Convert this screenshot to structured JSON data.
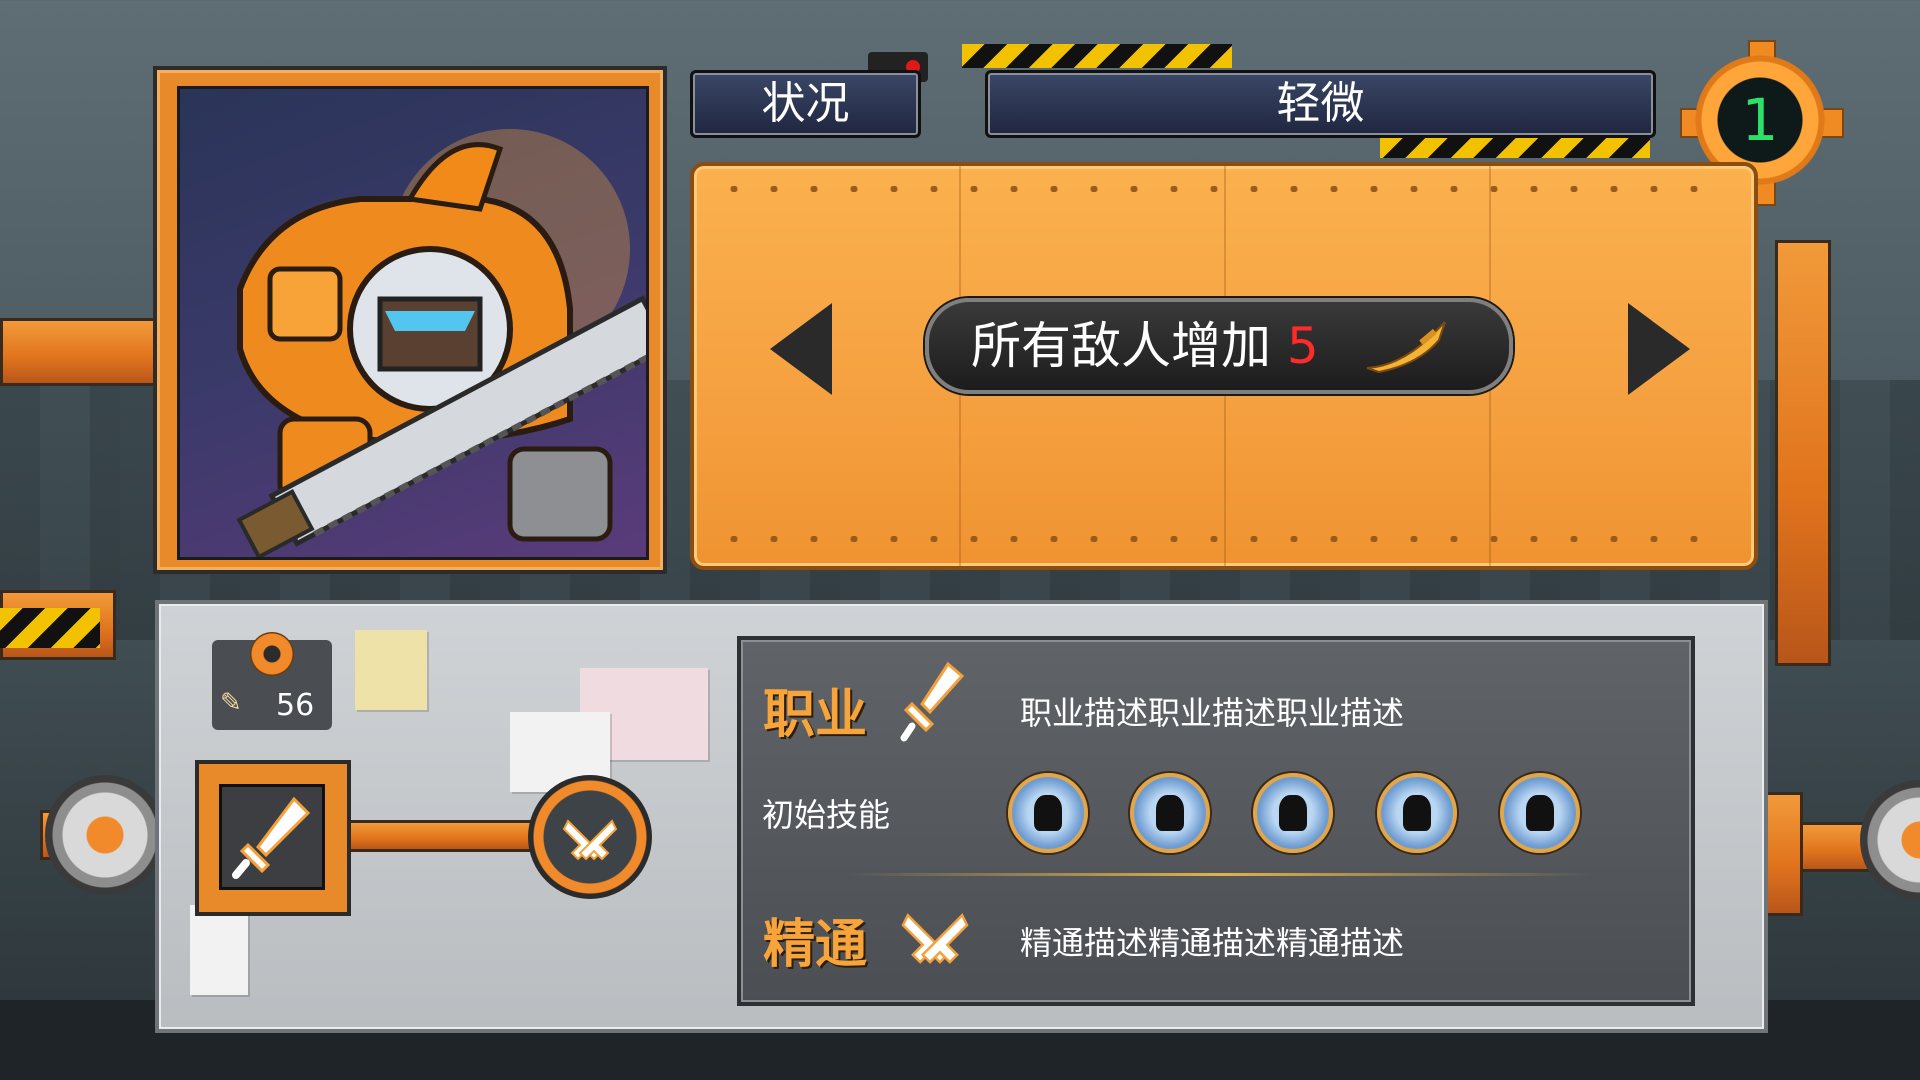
{
  "status": {
    "label": "状况",
    "level": "轻微"
  },
  "stage_number": "1",
  "effect": {
    "text": "所有敌人增加",
    "value": "5"
  },
  "resource": {
    "count": "56"
  },
  "profession": {
    "label": "职业",
    "description": "职业描述职业描述职业描述"
  },
  "skills": {
    "label": "初始技能",
    "count": 5
  },
  "mastery": {
    "label": "精通",
    "description": "精通描述精通描述精通描述"
  },
  "icons": {
    "sword": "sword-icon",
    "crossed_pistols": "crossed-pistols-icon",
    "scimitar": "scimitar-icon",
    "gear": "gear-icon"
  },
  "colors": {
    "accent": "#f5a040",
    "value_red": "#ff2a2a",
    "stage_green": "#2ee06a"
  }
}
